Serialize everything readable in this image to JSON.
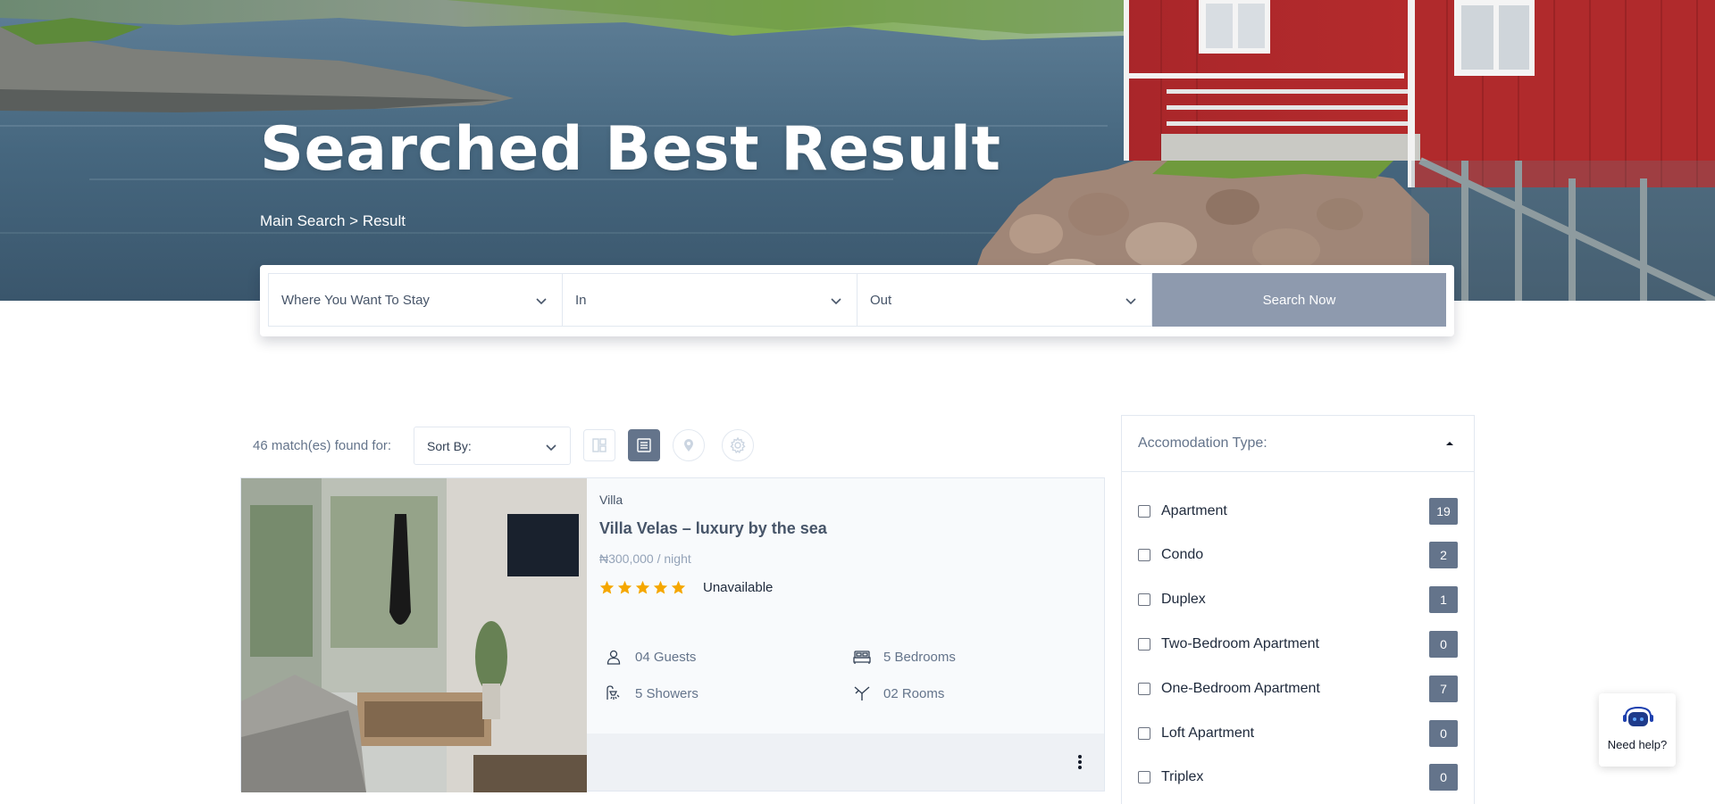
{
  "hero": {
    "title": "Searched Best Result",
    "breadcrumb": {
      "parent": "Main Search",
      "separator": " > ",
      "current": "Result"
    }
  },
  "search": {
    "where_label": "Where You Want To Stay",
    "in_label": "In",
    "out_label": "Out",
    "button_label": "Search Now",
    "icon": "chevron-down-icon"
  },
  "toolbar": {
    "matches_text": "46 match(es) found for:",
    "sort_label": "Sort By:",
    "view_buttons": [
      "grid-view-icon",
      "list-view-icon",
      "map-pin-icon",
      "settings-icon"
    ],
    "active_view": "list"
  },
  "listing": {
    "type": "Villa",
    "title": "Villa Velas – luxury by the sea",
    "price": "₦300,000 / night",
    "rating": 5,
    "status": "Unavailable",
    "guests": "04 Guests",
    "bedrooms": "5 Bedrooms",
    "showers": "5 Showers",
    "rooms": "02 Rooms",
    "star_color": "#f5a700"
  },
  "filter": {
    "title": "Accomodation Type:",
    "items": [
      {
        "label": "Apartment",
        "count": "19"
      },
      {
        "label": "Condo",
        "count": "2"
      },
      {
        "label": "Duplex",
        "count": "1"
      },
      {
        "label": "Two-Bedroom Apartment",
        "count": "0"
      },
      {
        "label": "One-Bedroom Apartment",
        "count": "7"
      },
      {
        "label": "Loft Apartment",
        "count": "0"
      },
      {
        "label": "Triplex",
        "count": "0"
      }
    ]
  },
  "help": {
    "label": "Need help?"
  },
  "colors": {
    "accent": "#64748b",
    "button": "#8e9aae",
    "star": "#f5a700"
  }
}
